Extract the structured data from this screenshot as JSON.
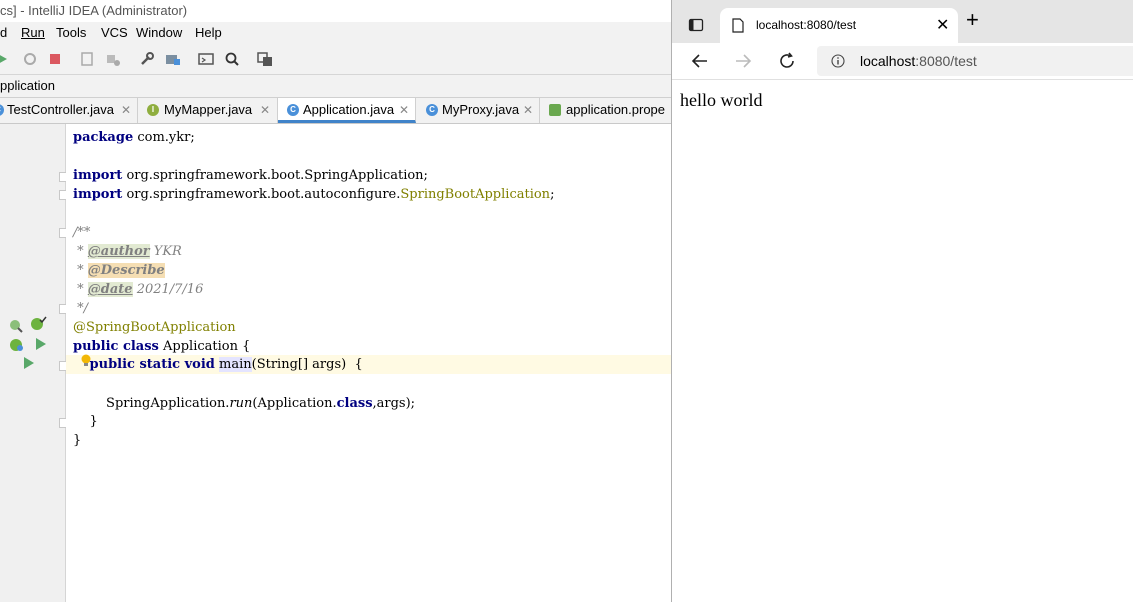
{
  "ide": {
    "window_title": "cs] - IntelliJ IDEA (Administrator)",
    "menu": [
      "d",
      "Run",
      "Tools",
      "VCS",
      "Window",
      "Help"
    ],
    "breadcrumb": "pplication",
    "tabs": [
      {
        "label": "TestController.java",
        "icon": "class-icon",
        "icon_letter": "C"
      },
      {
        "label": "MyMapper.java",
        "icon": "interface-icon",
        "icon_letter": "I"
      },
      {
        "label": "Application.java",
        "icon": "spring-class-icon",
        "icon_letter": "C",
        "active": true
      },
      {
        "label": "MyProxy.java",
        "icon": "class-icon",
        "icon_letter": "C"
      },
      {
        "label": "application.prope",
        "icon": "properties-icon",
        "icon_letter": ""
      }
    ],
    "code": {
      "l1_kw": "package",
      "l1_rest": " com.ykr;",
      "l3_kw": "import",
      "l3_rest": " org.springframework.boot.SpringApplication;",
      "l4_kw": "import",
      "l4_rest": " org.springframework.boot.autoconfigure.",
      "l4_ann": "SpringBootApplication",
      "l4_end": ";",
      "l6": "/**",
      "l7_star": " * ",
      "l7_tag": "@author",
      "l7_val": " YKR",
      "l8_star": " * ",
      "l8_tag": "@Describe",
      "l9_star": " * ",
      "l9_tag": "@date",
      "l9_val": " 2021/7/16",
      "l10": " */",
      "l11": "@SpringBootApplication",
      "l12_kw": "public class",
      "l12_rest": " Application {",
      "l13_indent": "    ",
      "l13_kw": "public static void",
      "l13_space": " ",
      "l13_name": "main",
      "l13_rest": "(String[] args)  {",
      "l15_indent": "        SpringApplication.",
      "l15_method": "run",
      "l15_mid": "(Application.",
      "l15_kw": "class",
      "l15_end": ",args);",
      "l16": "    }",
      "l17": "}"
    }
  },
  "browser": {
    "tab_title": "localhost:8080/test",
    "address_host": "localhost",
    "address_rest": ":8080/test",
    "page_text": "hello world",
    "new_tab_symbol": "+",
    "close_symbol": "✕"
  }
}
